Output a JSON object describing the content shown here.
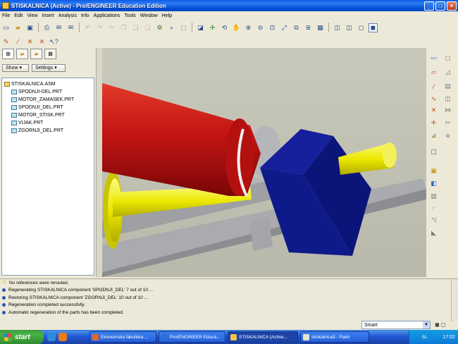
{
  "window": {
    "title": "STISKALNICA (Active) - Pro/ENGINEER Education Edition",
    "buttons": {
      "minimize": "_",
      "maximize": "□",
      "close": "✕"
    }
  },
  "menu": [
    "File",
    "Edit",
    "View",
    "Insert",
    "Analysis",
    "Info",
    "Applications",
    "Tools",
    "Window",
    "Help"
  ],
  "toolbar_main": [
    "new-icon",
    "open-icon",
    "save-icon",
    "print-icon",
    "email-icon",
    "undo-icon",
    "redo-icon",
    "cut-icon",
    "copy-icon",
    "paste-icon",
    "paste-special-icon",
    "regenerate-icon",
    "find-icon",
    "select-box-icon",
    "repaint-icon",
    "spin-center-icon",
    "orient-icon",
    "zoom-in-icon",
    "zoom-out-icon",
    "refit-icon",
    "reorient-icon",
    "saved-views-icon",
    "layers-icon",
    "wireframe-icon",
    "hidden-line-icon",
    "no-hidden-icon",
    "shading-icon"
  ],
  "left_panel": {
    "show_label": "Show",
    "settings_label": "Settings",
    "tree": {
      "root": "STISKALNICA.ASM",
      "items": [
        "SPODNJI-DEL.PRT",
        "MOTOR_ZAMASEK.PRT",
        "SPODNJI_DEL.PRT",
        "MOTOR_STISK.PRT",
        "VIJAK.PRT",
        "ZGORNJI_DEL.PRT"
      ]
    }
  },
  "messages": [
    {
      "text": "No references were rerouted.",
      "type": "warning"
    },
    {
      "text": "Regenerating STISKALNICA component 'SPODNJI_DEL' 7 out of 10 ...",
      "type": "info"
    },
    {
      "text": "Restoring STISKALNICA component 'ZGORNJI_DEL' 10 out of 10 ...",
      "type": "info"
    },
    {
      "text": "Regeneration completed successfully.",
      "type": "info"
    },
    {
      "text": "Automatic regeneration of the parts has been completed.",
      "type": "info"
    }
  ],
  "filter": {
    "value": "Smart"
  },
  "taskbar": {
    "start_label": "start",
    "tasks": [
      {
        "label": "Ekonomska fakulteta ...",
        "color": "#e0682a"
      },
      {
        "label": "Pro/ENGINEER Educa...",
        "color": "#2c6ed6"
      },
      {
        "label": "STISKALNICA (Active...",
        "color": "#f2c44a"
      },
      {
        "label": "stiskalnica3 - Paint",
        "color": "#e9e4c9"
      }
    ],
    "tray_lang": "SL",
    "clock": "17:02"
  },
  "colors": {
    "viewport_bg": "#c4c4b6",
    "red_part": "#c41414",
    "blue_part": "#0a1275",
    "yellow_part": "#f2f000",
    "grey_part": "#a6a8ac"
  }
}
